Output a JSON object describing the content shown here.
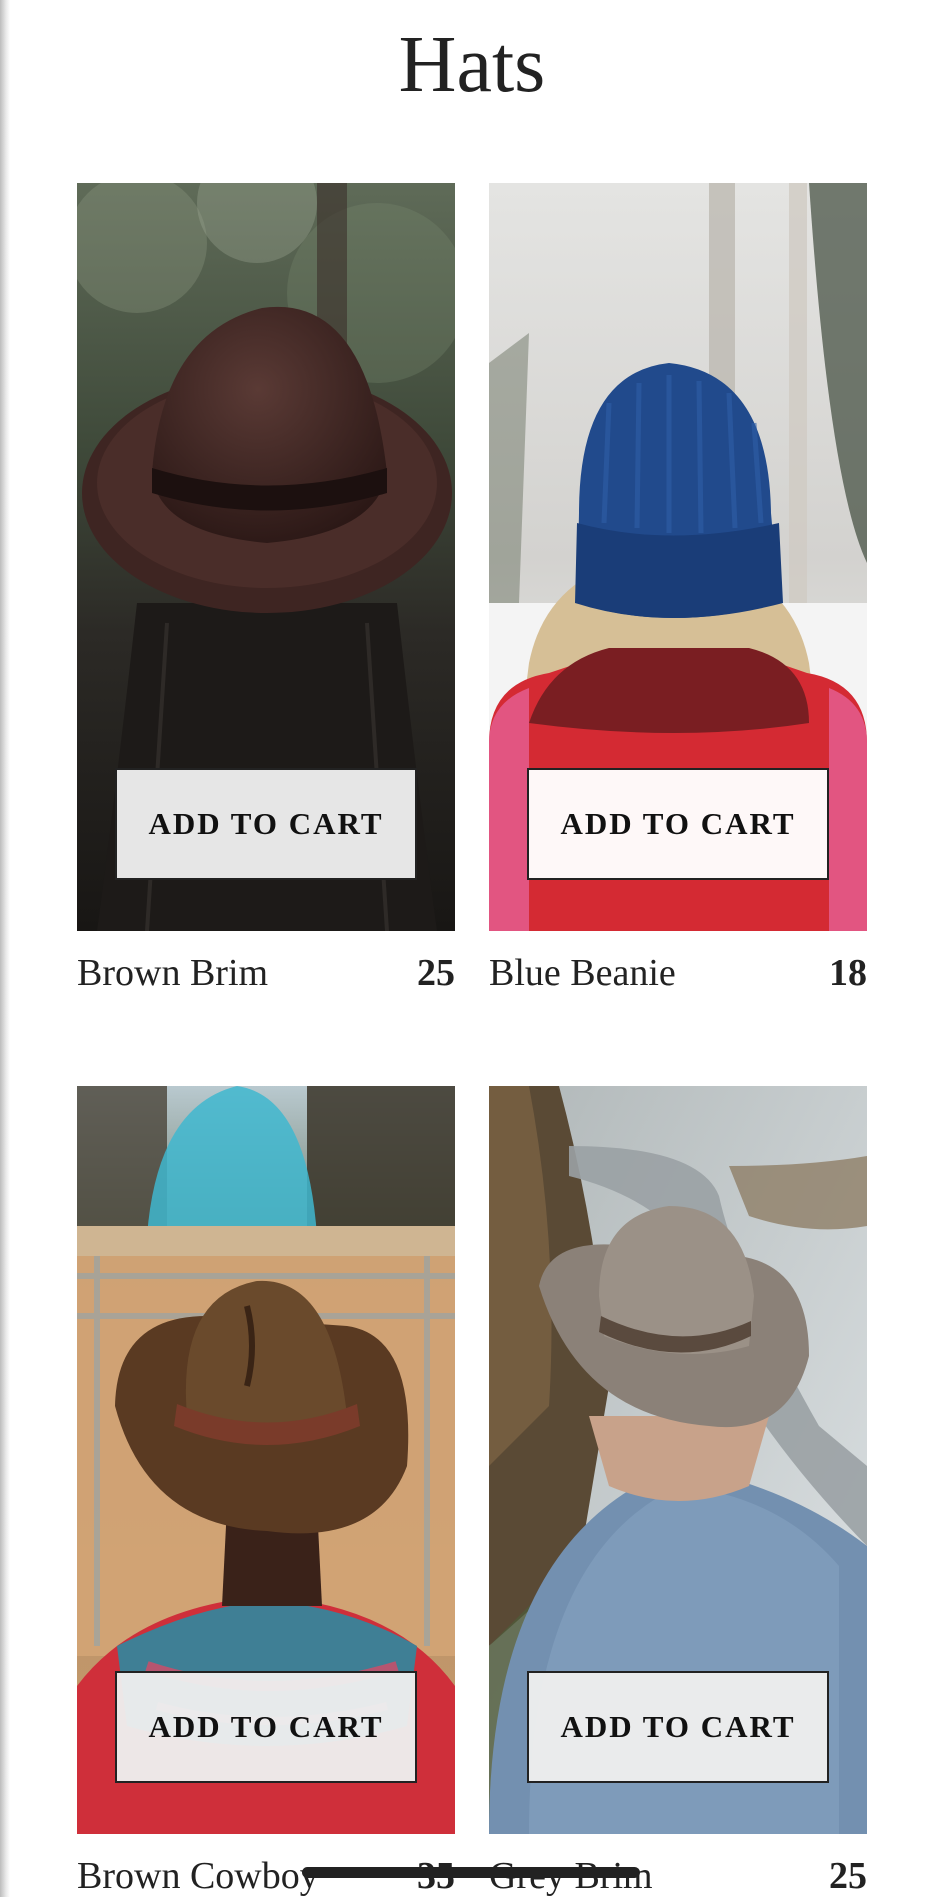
{
  "page": {
    "title": "Hats"
  },
  "products": [
    {
      "name": "Brown Brim",
      "price": "25",
      "button_label": "ADD TO CART",
      "image_icon": "brown-brim-hat-photo"
    },
    {
      "name": "Blue Beanie",
      "price": "18",
      "button_label": "ADD TO CART",
      "image_icon": "blue-beanie-photo"
    },
    {
      "name": "Brown Cowboy",
      "price": "35",
      "button_label": "ADD TO CART",
      "image_icon": "brown-cowboy-hat-photo"
    },
    {
      "name": "Grey Brim",
      "price": "25",
      "button_label": "ADD TO CART",
      "image_icon": "grey-brim-hat-photo"
    }
  ],
  "colors": {
    "text": "#222222",
    "button_background": "#eeeeee",
    "button_border": "#222222"
  }
}
